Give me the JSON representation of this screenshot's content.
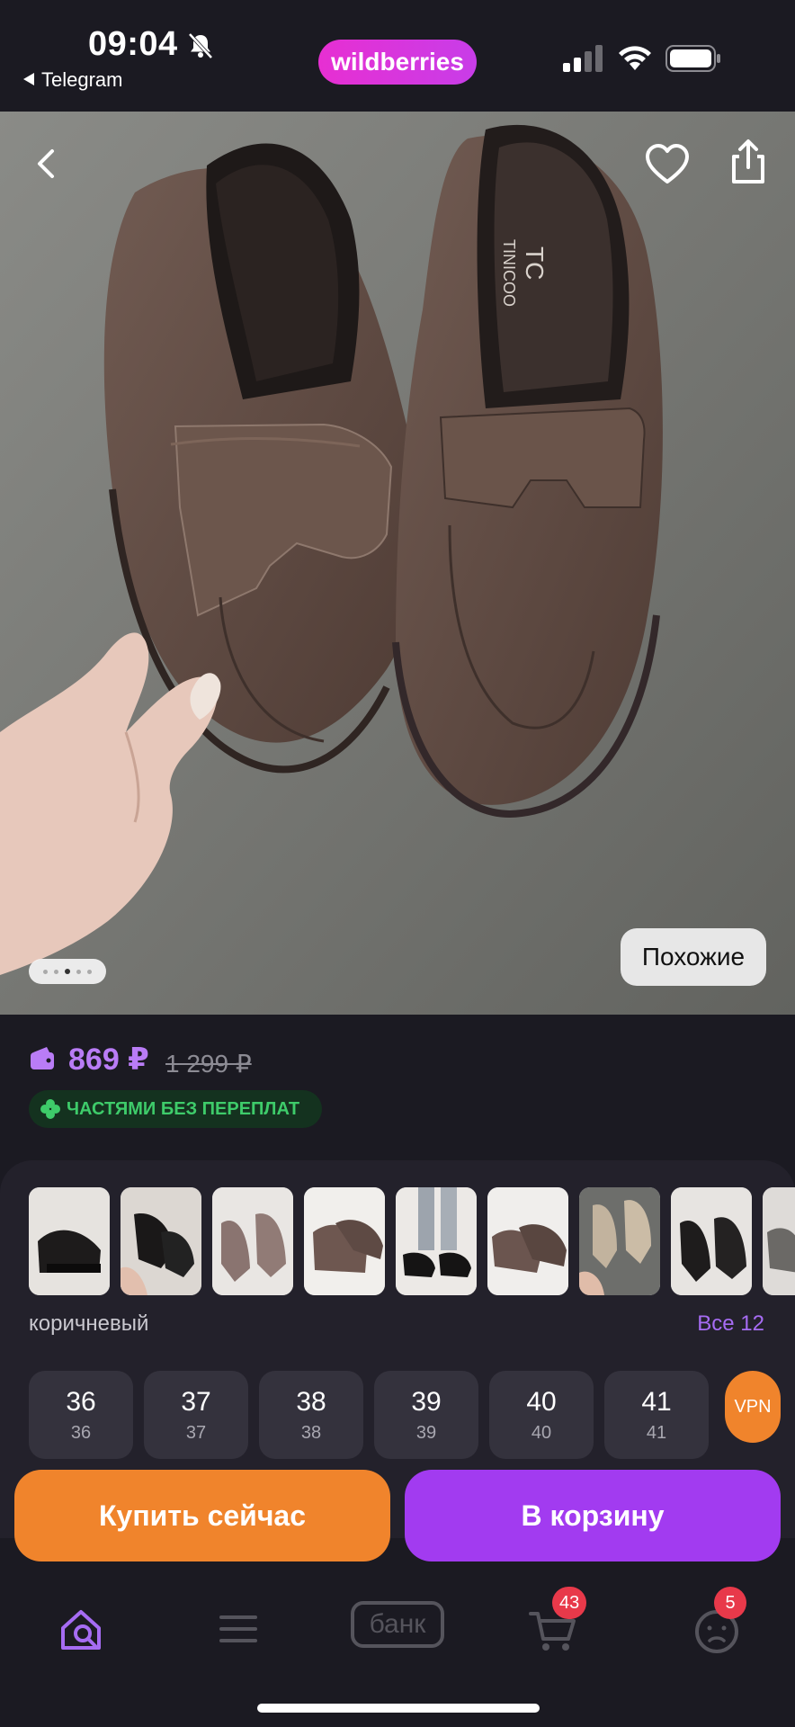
{
  "status_bar": {
    "time": "09:04",
    "back_app": "Telegram",
    "brand": "wildberries"
  },
  "hero": {
    "similar_label": "Похожие",
    "insole_brand": "TINICOO",
    "insole_logo": "TC"
  },
  "price": {
    "current": "869 ₽",
    "old": "1 299 ₽",
    "installments": "ЧАСТЯМИ БЕЗ ПЕРЕПЛАТ"
  },
  "variants": {
    "color_name": "коричневый",
    "all_link": "Все 12",
    "thumbnails": [
      "black",
      "black",
      "taupe",
      "brown",
      "black",
      "brown",
      "beige",
      "black",
      "grey"
    ]
  },
  "sizes": [
    {
      "label": "36",
      "sub": "36"
    },
    {
      "label": "37",
      "sub": "37"
    },
    {
      "label": "38",
      "sub": "38"
    },
    {
      "label": "39",
      "sub": "39"
    },
    {
      "label": "40",
      "sub": "40"
    },
    {
      "label": "41",
      "sub": "41"
    }
  ],
  "vpn_badge": "VPN",
  "actions": {
    "buy_now": "Купить сейчас",
    "to_cart": "В корзину"
  },
  "tabbar": {
    "bank_label": "банк",
    "cart_count": "43",
    "profile_count": "5"
  },
  "colors": {
    "accent_purple": "#a23bf0",
    "accent_orange": "#f0842c",
    "price_purple": "#b97cf6",
    "installment_green": "#3ecb6a"
  }
}
